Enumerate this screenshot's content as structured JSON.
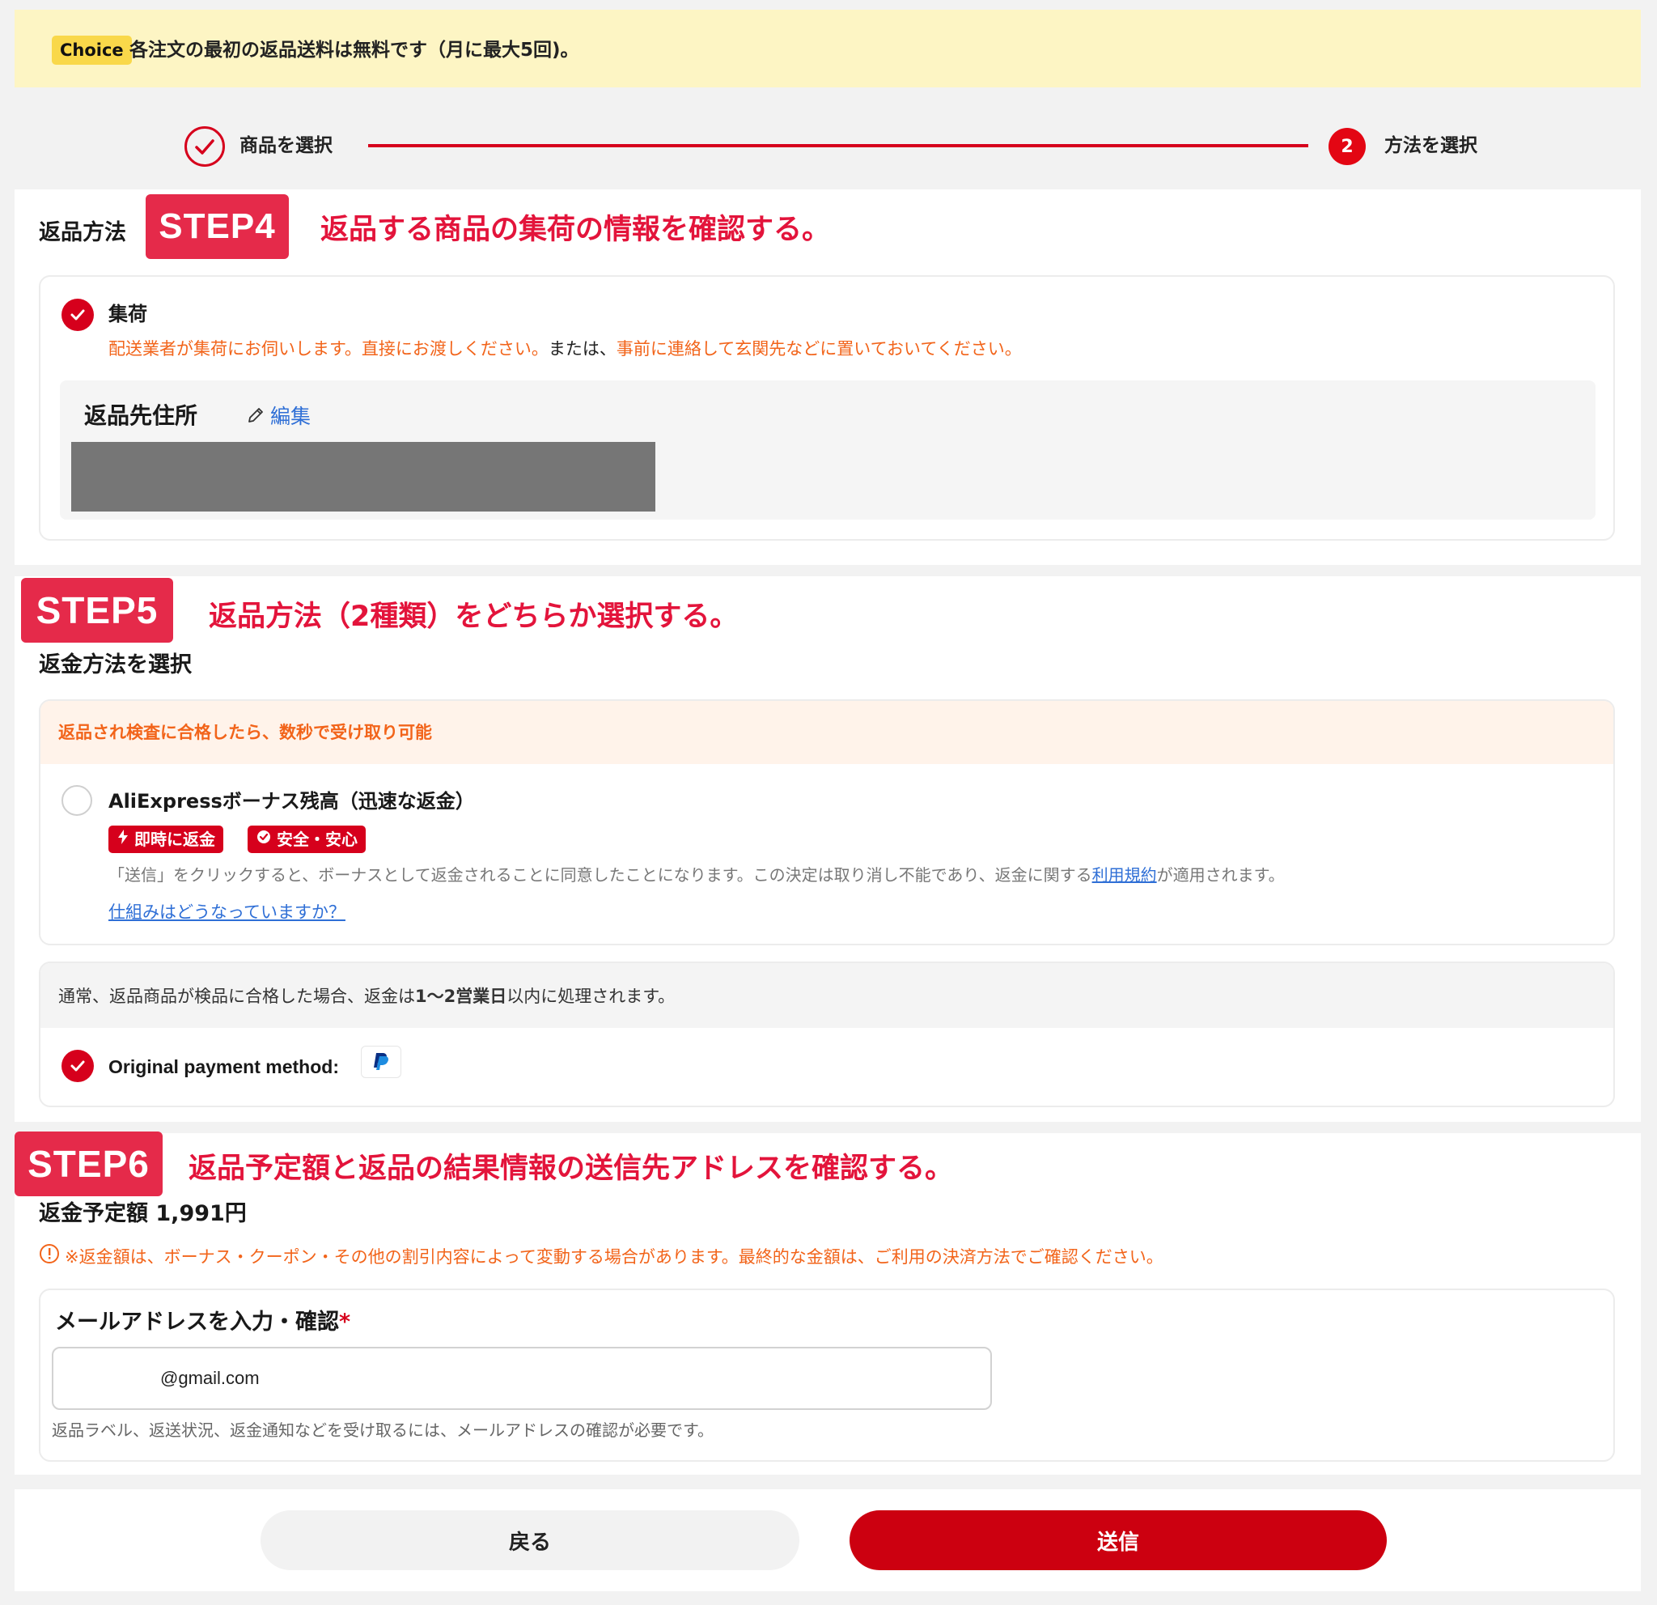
{
  "banner": {
    "badge": "Choice",
    "text": "各注文の最初の返品送料は無料です（月に最大5回)。"
  },
  "progress": {
    "step1_label": "商品を選択",
    "step2_number": "2",
    "step2_label": "方法を選択"
  },
  "step4": {
    "badge": "STEP4",
    "section_label": "返品方法",
    "annotation": "返品する商品の集荷の情報を確認する。",
    "option_title": "集荷",
    "option_desc_1": "配送業者が集荷にお伺いします。直接にお渡しください。",
    "option_desc_2": "または、",
    "option_desc_3": "事前に連絡して玄関先などに置いておいてください。",
    "address_label": "返品先住所",
    "edit_label": "編集"
  },
  "step5": {
    "badge": "STEP5",
    "annotation": "返品方法（2種類）をどちらか選択する。",
    "refund_label": "返金方法を選択",
    "bonus_notice": "返品され検査に合格したら、数秒で受け取り可能",
    "bonus_option": "AliExpressボーナス残高（迅速な返金）",
    "tag_instant": "即時に返金",
    "tag_safe": "安全・安心",
    "bonus_desc_pre": "「送信」をクリックすると、ボーナスとして返金されることに同意したことになります。この決定は取り消し不能であり、返金に関する",
    "bonus_desc_link": "利用規約",
    "bonus_desc_post": "が適用されます。",
    "how_link": "仕組みはどうなっていますか？",
    "normal_notice_pre": "通常、返品商品が検品に合格した場合、返金は",
    "normal_notice_bold": "1〜2営業日",
    "normal_notice_post": "以内に処理されます。",
    "original_payment": "Original payment method:"
  },
  "step6": {
    "badge": "STEP6",
    "annotation": "返品予定額と返品の結果情報の送信先アドレスを確認する。",
    "refund_amount": "返金予定額 1,991円",
    "refund_note": "※返金額は、ボーナス・クーポン・その他の割引内容によって変動する場合があります。最終的な金額は、ご利用の決済方法でご確認ください。",
    "email_label": "メールアドレスを入力・確認",
    "required_mark": "*",
    "email_value": "@gmail.com",
    "email_help": "返品ラベル、返送状況、返金通知などを受け取るには、メールアドレスの確認が必要です。"
  },
  "footer": {
    "back_label": "戻る",
    "submit_label": "送信"
  },
  "colors": {
    "accent": "#d6001c",
    "step_badge": "#e52a4a",
    "orange_text": "#f2641a",
    "link": "#2f6fd6"
  }
}
